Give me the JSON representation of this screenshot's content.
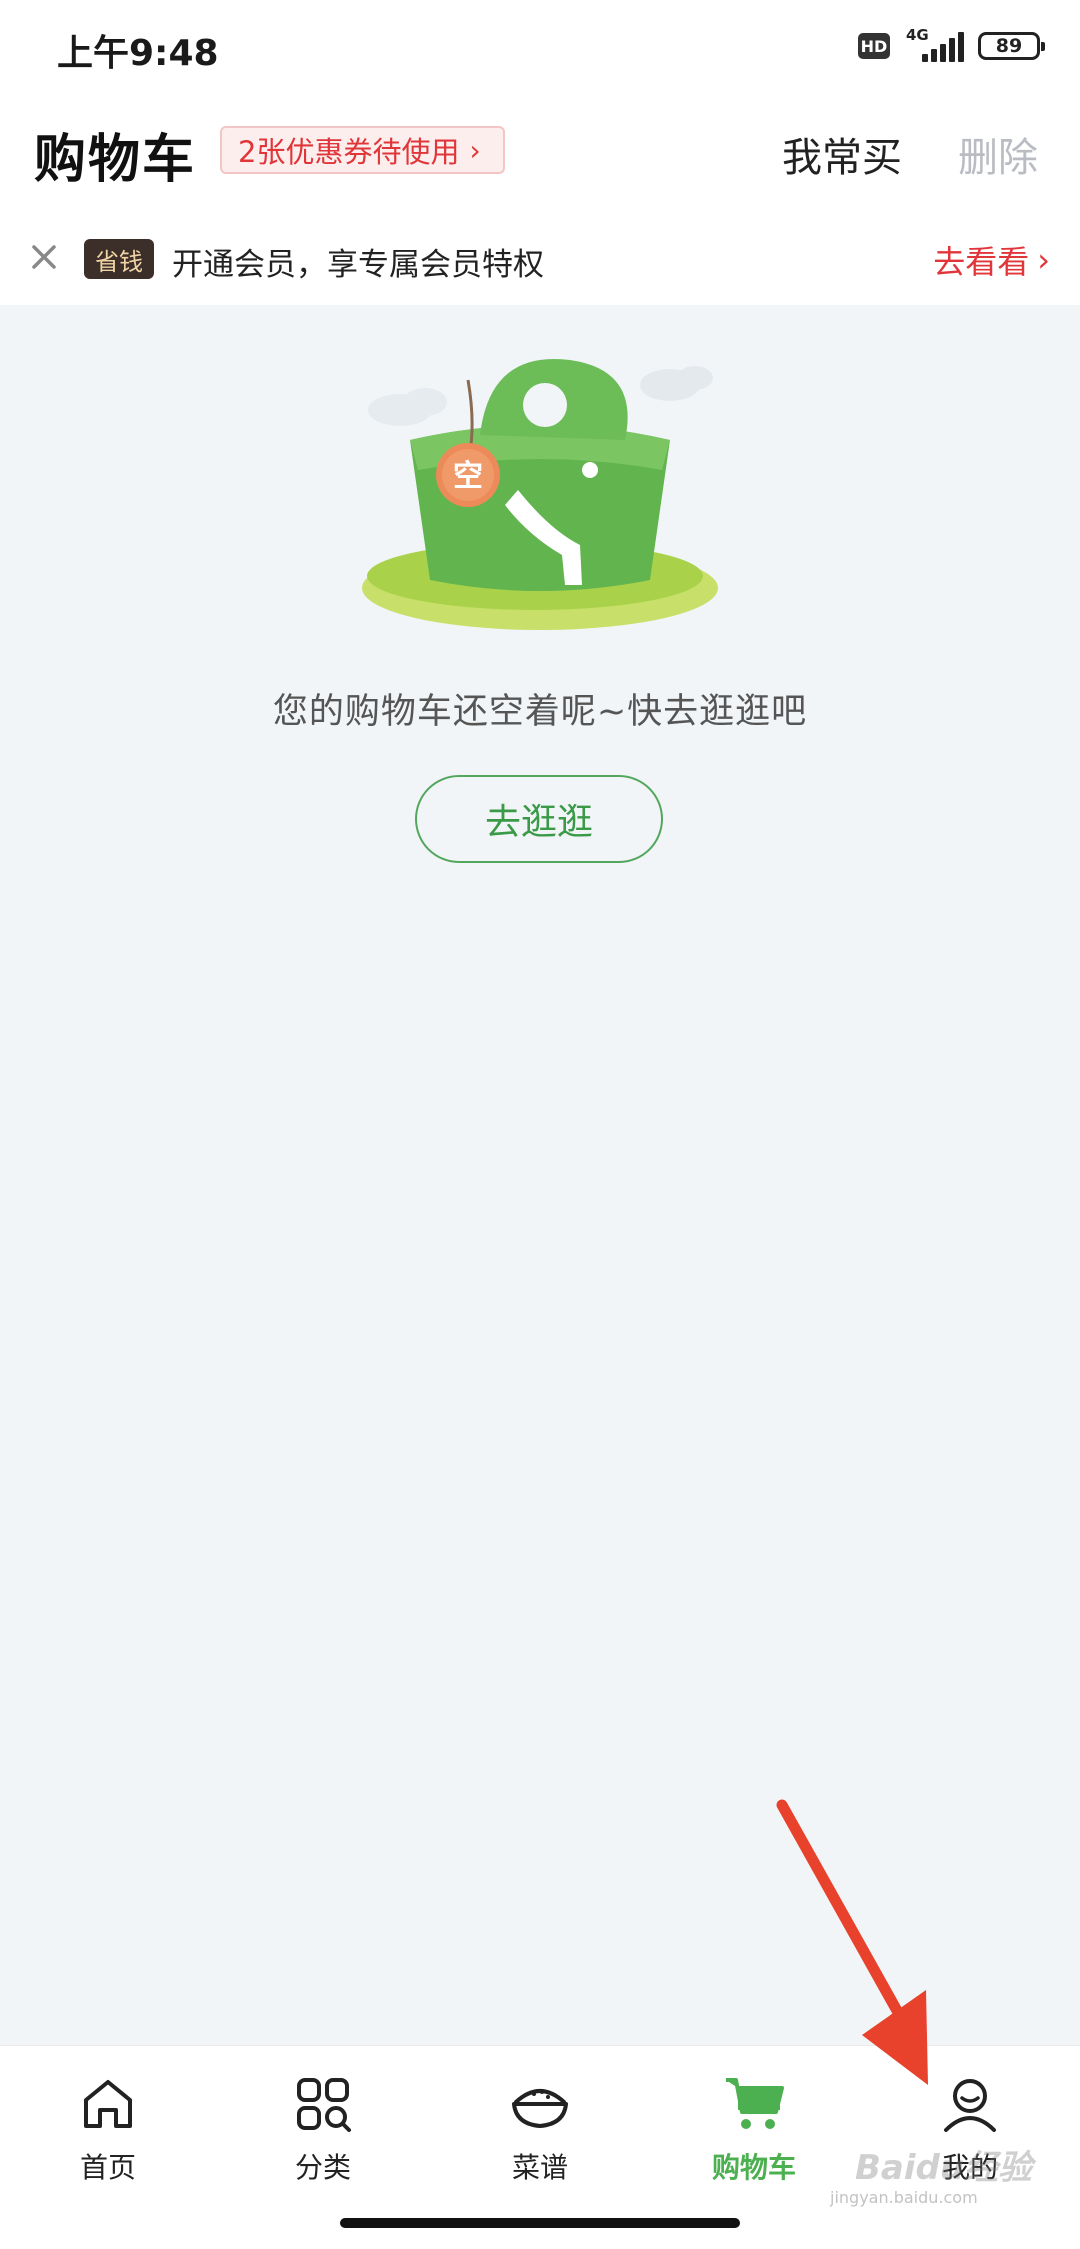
{
  "status_bar": {
    "time": "上午9:48",
    "hd": "HD",
    "network": "4G",
    "battery": "89"
  },
  "header": {
    "title": "购物车",
    "coupon": "2张优惠券待使用",
    "frequent": "我常买",
    "delete": "删除"
  },
  "member_banner": {
    "tag": "省钱",
    "text": "开通会员，享专属会员特权",
    "link": "去看看"
  },
  "empty_state": {
    "illustration_tag": "空",
    "message": "您的购物车还空着呢~快去逛逛吧",
    "button": "去逛逛"
  },
  "bottom_nav": {
    "items": [
      {
        "label": "首页",
        "icon": "home-icon",
        "active": false
      },
      {
        "label": "分类",
        "icon": "category-icon",
        "active": false
      },
      {
        "label": "菜谱",
        "icon": "recipe-icon",
        "active": false
      },
      {
        "label": "购物车",
        "icon": "cart-icon",
        "active": true
      },
      {
        "label": "我的",
        "icon": "profile-icon",
        "active": false
      }
    ]
  },
  "colors": {
    "accent": "#4cb050",
    "warning": "#e0363a",
    "annotation_arrow": "#e8412c"
  },
  "watermark": {
    "brand": "Baidu经验",
    "url": "jingyan.baidu.com"
  }
}
